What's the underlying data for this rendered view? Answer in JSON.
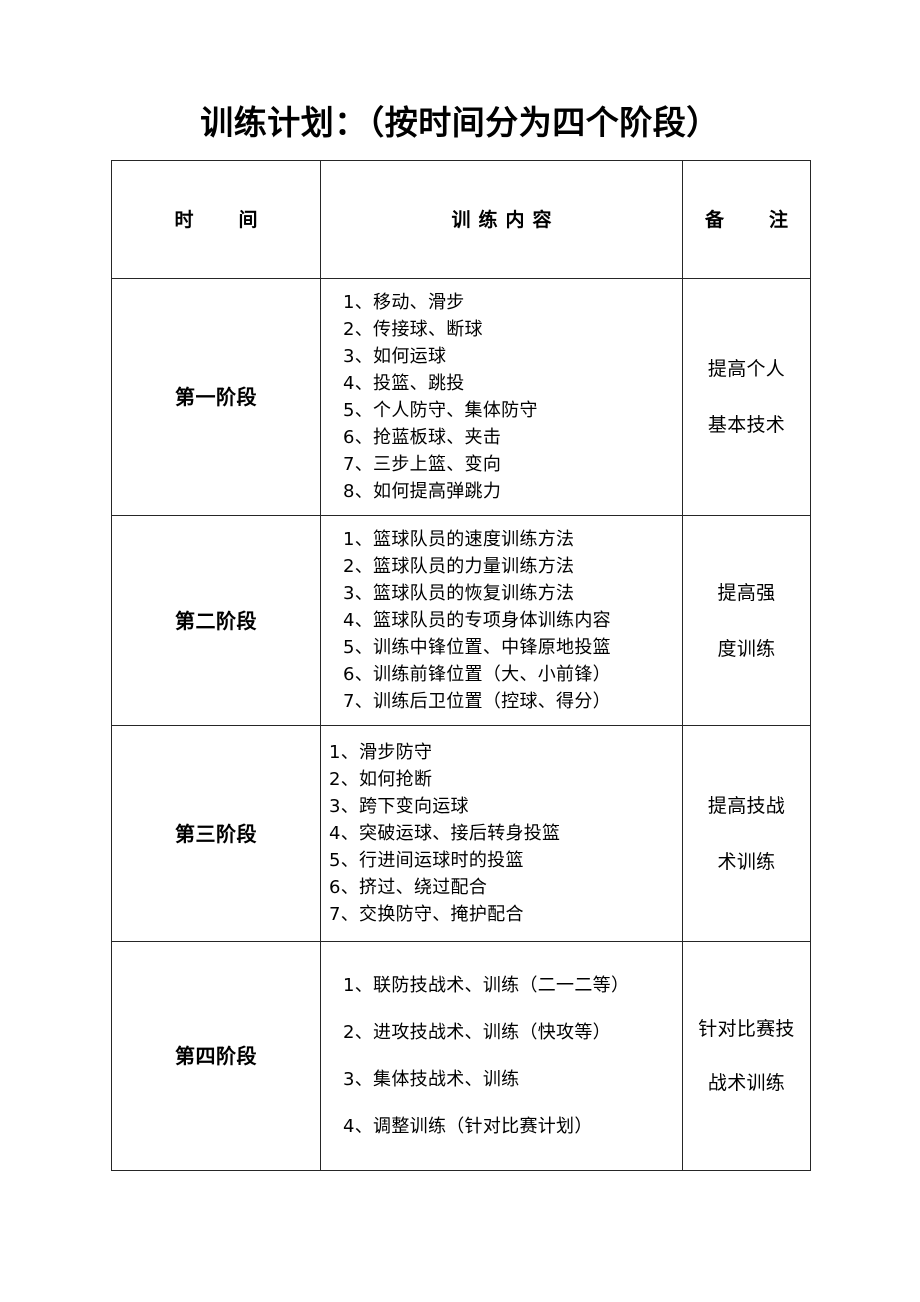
{
  "document": {
    "title": "训练计划：（按时间分为四个阶段）"
  },
  "table": {
    "headers": {
      "time": "时　间",
      "content": "训练内容",
      "remark": "备　注"
    },
    "rows": [
      {
        "phase": "第一阶段",
        "items": [
          "1、移动、滑步",
          "2、传接球、断球",
          "3、如何运球",
          "4、投篮、跳投",
          "5、个人防守、集体防守",
          "6、抢蓝板球、夹击",
          "7、三步上篮、变向",
          "8、如何提高弹跳力"
        ],
        "remark_line1": "提高个人",
        "remark_line2": "基本技术"
      },
      {
        "phase": "第二阶段",
        "items": [
          "1、篮球队员的速度训练方法",
          "2、篮球队员的力量训练方法",
          "3、篮球队员的恢复训练方法",
          "4、篮球队员的专项身体训练内容",
          "5、训练中锋位置、中锋原地投篮",
          "6、训练前锋位置（大、小前锋）",
          "7、训练后卫位置（控球、得分）"
        ],
        "remark_line1": "提高强",
        "remark_line2": "度训练"
      },
      {
        "phase": "第三阶段",
        "items": [
          "1、滑步防守",
          "2、如何抢断",
          "3、跨下变向运球",
          "4、突破运球、接后转身投篮",
          "5、行进间运球时的投篮",
          "6、挤过、绕过配合",
          "7、交换防守、掩护配合"
        ],
        "remark_line1": "提高技战",
        "remark_line2": "术训练"
      },
      {
        "phase": "第四阶段",
        "items": [
          "1、联防技战术、训练（二一二等）",
          "2、进攻技战术、训练（快攻等）",
          "3、集体技战术、训练",
          "4、调整训练（针对比赛计划）"
        ],
        "remark_line1": "针对比赛技",
        "remark_line2": "战术训练"
      }
    ]
  }
}
